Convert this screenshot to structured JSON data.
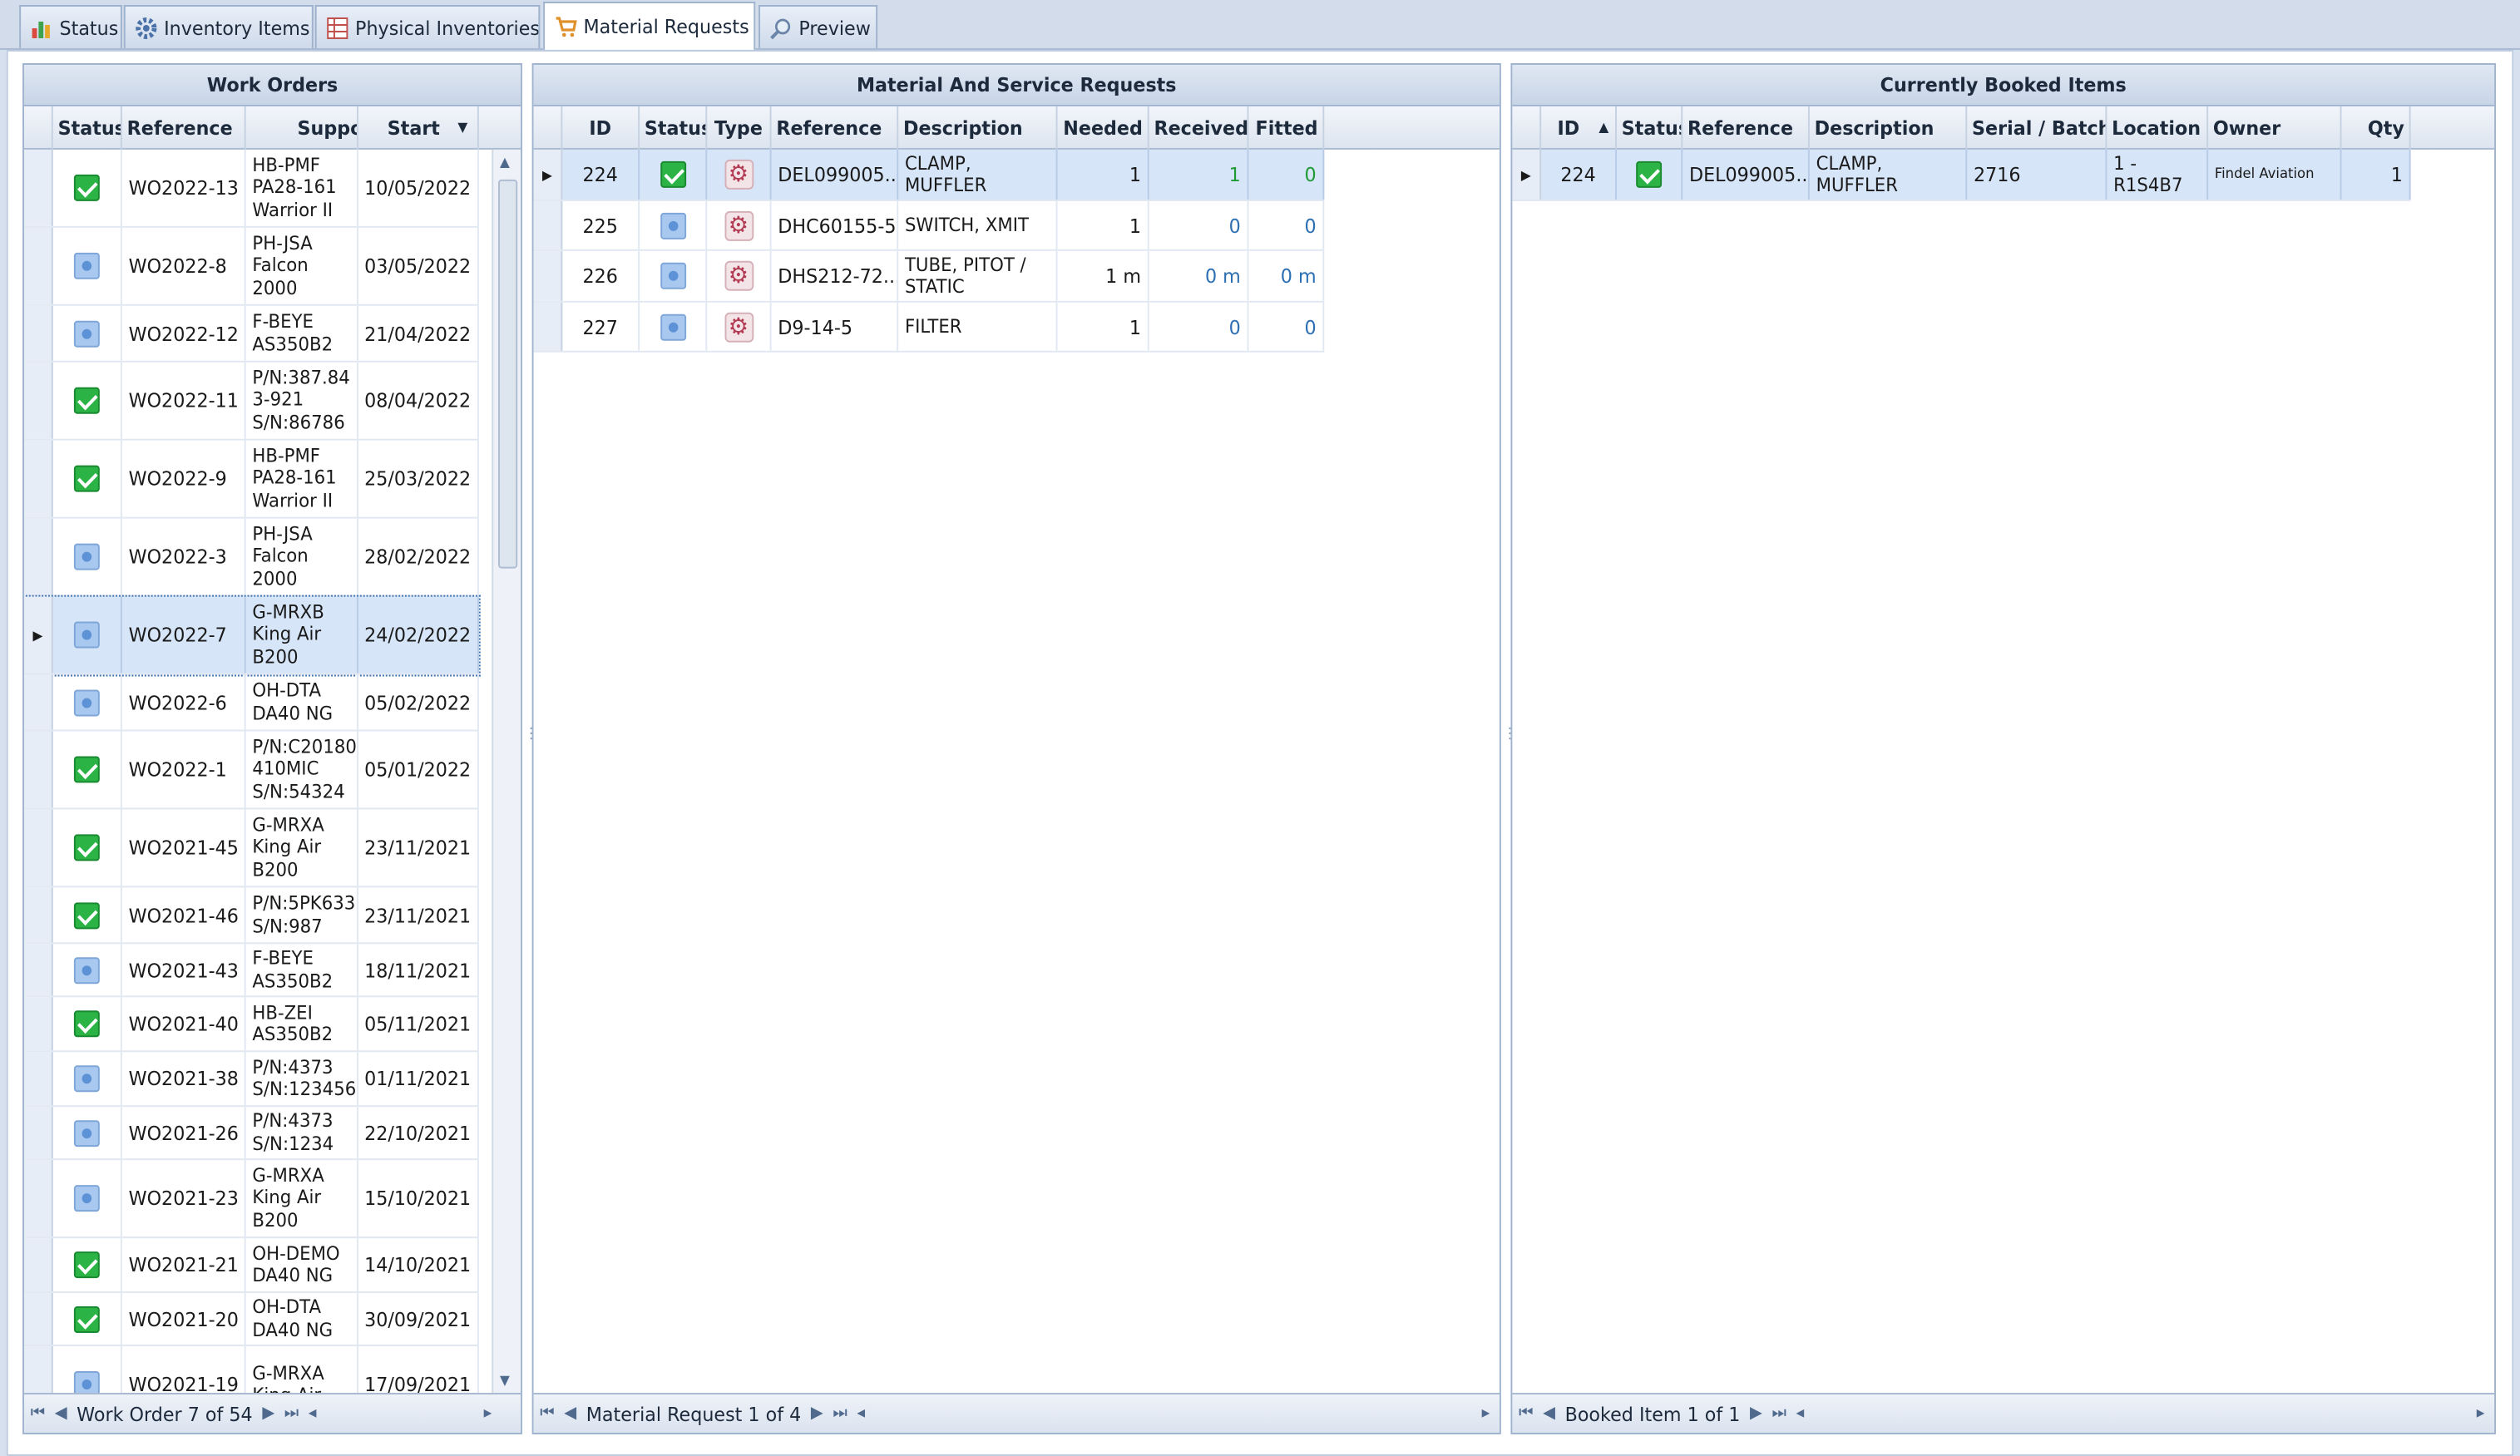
{
  "tabs": [
    {
      "label": "Status",
      "icon": "chart-icon"
    },
    {
      "label": "Inventory Items",
      "icon": "gear-icon"
    },
    {
      "label": "Physical Inventories",
      "icon": "table-icon"
    },
    {
      "label": "Material Requests",
      "icon": "cart-icon",
      "active": true
    },
    {
      "label": "Preview",
      "icon": "magnifier-icon"
    }
  ],
  "work_orders": {
    "title": "Work Orders",
    "columns": [
      "Status",
      "Reference",
      "Support",
      "Start"
    ],
    "rows": [
      {
        "status": "done",
        "reference": "WO2022-13",
        "support": "HB-PMF PA28-161 Warrior II",
        "start": "10/05/2022"
      },
      {
        "status": "pending",
        "reference": "WO2022-8",
        "support": "PH-JSA Falcon 2000",
        "start": "03/05/2022"
      },
      {
        "status": "pending",
        "reference": "WO2022-12",
        "support": "F-BEYE AS350B2",
        "start": "21/04/2022"
      },
      {
        "status": "done",
        "reference": "WO2022-11",
        "support": "P/N:387.84 3-921 S/N:86786",
        "start": "08/04/2022"
      },
      {
        "status": "done",
        "reference": "WO2022-9",
        "support": "HB-PMF PA28-161 Warrior II",
        "start": "25/03/2022"
      },
      {
        "status": "pending",
        "reference": "WO2022-3",
        "support": "PH-JSA Falcon 2000",
        "start": "28/02/2022"
      },
      {
        "status": "pending",
        "reference": "WO2022-7",
        "support": "G-MRXB King Air B200",
        "start": "24/02/2022",
        "selected": true
      },
      {
        "status": "pending",
        "reference": "WO2022-6",
        "support": "OH-DTA DA40 NG",
        "start": "05/02/2022"
      },
      {
        "status": "done",
        "reference": "WO2022-1",
        "support": "P/N:C20180 410MIC S/N:54324",
        "start": "05/01/2022"
      },
      {
        "status": "done",
        "reference": "WO2021-45",
        "support": "G-MRXA King Air B200",
        "start": "23/11/2021"
      },
      {
        "status": "done",
        "reference": "WO2021-46",
        "support": "P/N:5PK633 S/N:987",
        "start": "23/11/2021"
      },
      {
        "status": "pending",
        "reference": "WO2021-43",
        "support": "F-BEYE AS350B2",
        "start": "18/11/2021"
      },
      {
        "status": "done",
        "reference": "WO2021-40",
        "support": "HB-ZEI AS350B2",
        "start": "05/11/2021"
      },
      {
        "status": "pending",
        "reference": "WO2021-38",
        "support": "P/N:4373 S/N:123456",
        "start": "01/11/2021"
      },
      {
        "status": "pending",
        "reference": "WO2021-26",
        "support": "P/N:4373 S/N:1234",
        "start": "22/10/2021"
      },
      {
        "status": "pending",
        "reference": "WO2021-23",
        "support": "G-MRXA King Air B200",
        "start": "15/10/2021"
      },
      {
        "status": "done",
        "reference": "WO2021-21",
        "support": "OH-DEMO DA40 NG",
        "start": "14/10/2021"
      },
      {
        "status": "done",
        "reference": "WO2021-20",
        "support": "OH-DTA DA40 NG",
        "start": "30/09/2021"
      },
      {
        "status": "pending",
        "reference": "WO2021-19",
        "support": "G-MRXA King Air",
        "start": "17/09/2021"
      }
    ],
    "nav_text": "Work Order 7 of 54"
  },
  "requests": {
    "title": "Material And Service Requests",
    "columns": [
      "ID",
      "Status",
      "Type",
      "Reference",
      "Description",
      "Needed",
      "Received",
      "Fitted"
    ],
    "rows": [
      {
        "id": "224",
        "status": "done",
        "reference": "DEL099005...",
        "description": "CLAMP, MUFFLER",
        "needed": "1",
        "received": "1",
        "fitted": "0",
        "selected": true
      },
      {
        "id": "225",
        "status": "pending",
        "reference": "DHC60155-5",
        "description": "SWITCH, XMIT",
        "needed": "1",
        "received": "0",
        "fitted": "0"
      },
      {
        "id": "226",
        "status": "pending",
        "reference": "DHS212-72...",
        "description": "TUBE, PITOT / STATIC",
        "needed": "1 m",
        "received": "0 m",
        "fitted": "0 m"
      },
      {
        "id": "227",
        "status": "pending",
        "reference": "D9-14-5",
        "description": "FILTER",
        "needed": "1",
        "received": "0",
        "fitted": "0"
      }
    ],
    "nav_text": "Material Request 1 of 4"
  },
  "booked": {
    "title": "Currently Booked Items",
    "columns": [
      "ID",
      "Status",
      "Reference",
      "Description",
      "Serial / Batch",
      "Location",
      "Owner",
      "Qty"
    ],
    "rows": [
      {
        "id": "224",
        "status": "done",
        "reference": "DEL099005...",
        "description": "CLAMP, MUFFLER",
        "serial": "2716",
        "location": "1 - R1S4B7",
        "owner": "Findel Aviation",
        "qty": "1"
      }
    ],
    "nav_text": "Booked Item 1 of 1"
  }
}
